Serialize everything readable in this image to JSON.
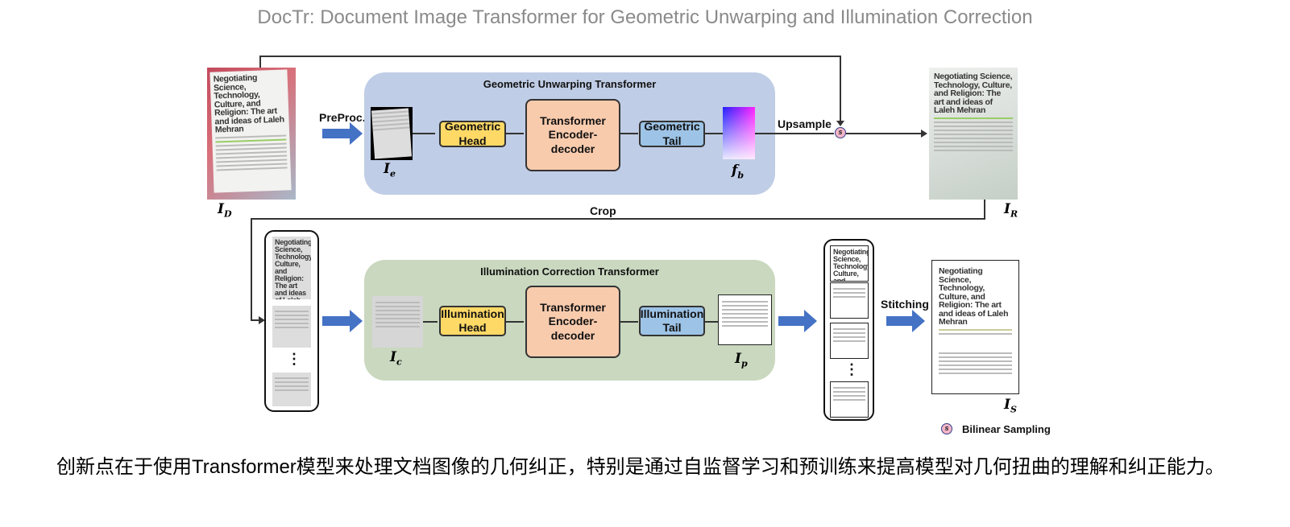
{
  "title": "DocTr: Document Image Transformer for Geometric Unwarping and Illumination Correction",
  "geometric": {
    "title": "Geometric Unwarping Transformer",
    "head": "Geometric Head",
    "encoder": "Transformer Encoder-decoder",
    "tail": "Geometric Tail",
    "color": "#c0cde6"
  },
  "illumination": {
    "title": "Illumination Correction Transformer",
    "head": "Illumination Head",
    "encoder": "Transformer Encoder-decoder",
    "tail": "Illumination Tail",
    "color": "#c9d8bf"
  },
  "labels": {
    "preproc": "PreProc.",
    "upsample": "Upsample",
    "crop": "Crop",
    "stitching": "Stitching",
    "ellipsis": "⋮"
  },
  "symbols": {
    "I_D": "I",
    "I_D_sub": "D",
    "I_e": "I",
    "I_e_sub": "e",
    "f_b": "f",
    "f_b_sub": "b",
    "I_R": "I",
    "I_R_sub": "R",
    "I_c": "I",
    "I_c_sub": "c",
    "I_p": "I",
    "I_p_sub": "p",
    "I_S": "I",
    "I_S_sub": "S",
    "s": "s"
  },
  "legend": {
    "symbol": "s",
    "label": "Bilinear Sampling"
  },
  "document_text": "Negotiating Science, Technology, Culture, and Religion: The art and ideas of Laleh Mehran",
  "caption": "创新点在于使用Transformer模型来处理文档图像的几何纠正，特别是通过自监督学习和预训练来提高模型对几何扭曲的理解和纠正能力。",
  "colors": {
    "head": "#ffd966",
    "encoder": "#f8cbad",
    "tail": "#9dc3e6",
    "arrow": "#4472c4"
  }
}
